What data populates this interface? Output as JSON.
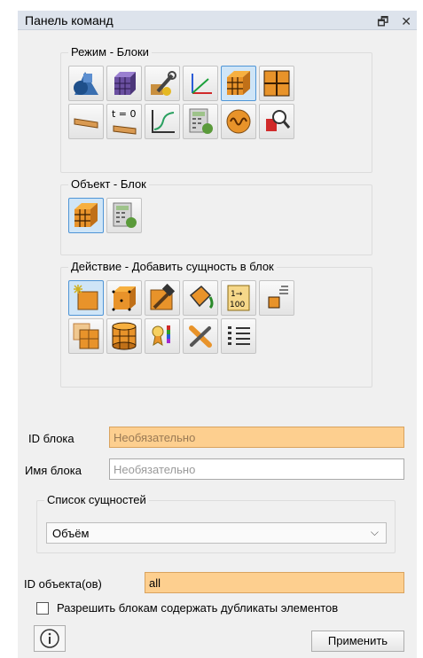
{
  "window": {
    "title": "Панель команд",
    "float_icon": "restore-icon",
    "close_icon": "close-icon"
  },
  "groups": {
    "mode": "Режим - Блоки",
    "object": "Объект - Блок",
    "action": "Действие - Добавить сущность в блок"
  },
  "mode_buttons": [
    "geometry-icon",
    "mesh-icon",
    "tools-icon",
    "coordinate-axes-icon",
    "block-icon",
    "partition-grid-icon",
    "bar-icon",
    "time-zero-icon",
    "plot-curve-icon",
    "calculator-settings-icon",
    "wave-function-icon",
    "zoom-inspect-icon"
  ],
  "mode_texts": {
    "t0": "t = 0"
  },
  "object_buttons": [
    "block-icon",
    "calculator-settings-icon"
  ],
  "action_buttons": [
    "add-entity-icon",
    "node-block-icon",
    "hammer-icon",
    "paint-bucket-icon",
    "renumber-icon",
    "small-block-list-icon",
    "split-block-icon",
    "cylinder-block-icon",
    "ribbon-legend-icon",
    "delete-icon",
    "list-icon"
  ],
  "action_texts": {
    "renumber_top": "1→",
    "renumber_bottom": "100"
  },
  "form": {
    "block_id_label": "ID блока",
    "block_id_placeholder": "Необязательно",
    "block_name_label": "Имя блока",
    "block_name_placeholder": "Необязательно",
    "entity_list_title": "Список сущностей",
    "entity_type": "Объём",
    "object_ids_label": "ID объекта(ов)",
    "object_ids_value": "all",
    "allow_duplicates_label": "Разрешить блокам содержать дубликаты элементов",
    "allow_duplicates_checked": false,
    "apply_label": "Применить",
    "info_icon": "info-icon"
  },
  "colors": {
    "required_field": "#fdcf8f",
    "active_button": "#cfe5f7",
    "accent": "#4f95d6"
  }
}
